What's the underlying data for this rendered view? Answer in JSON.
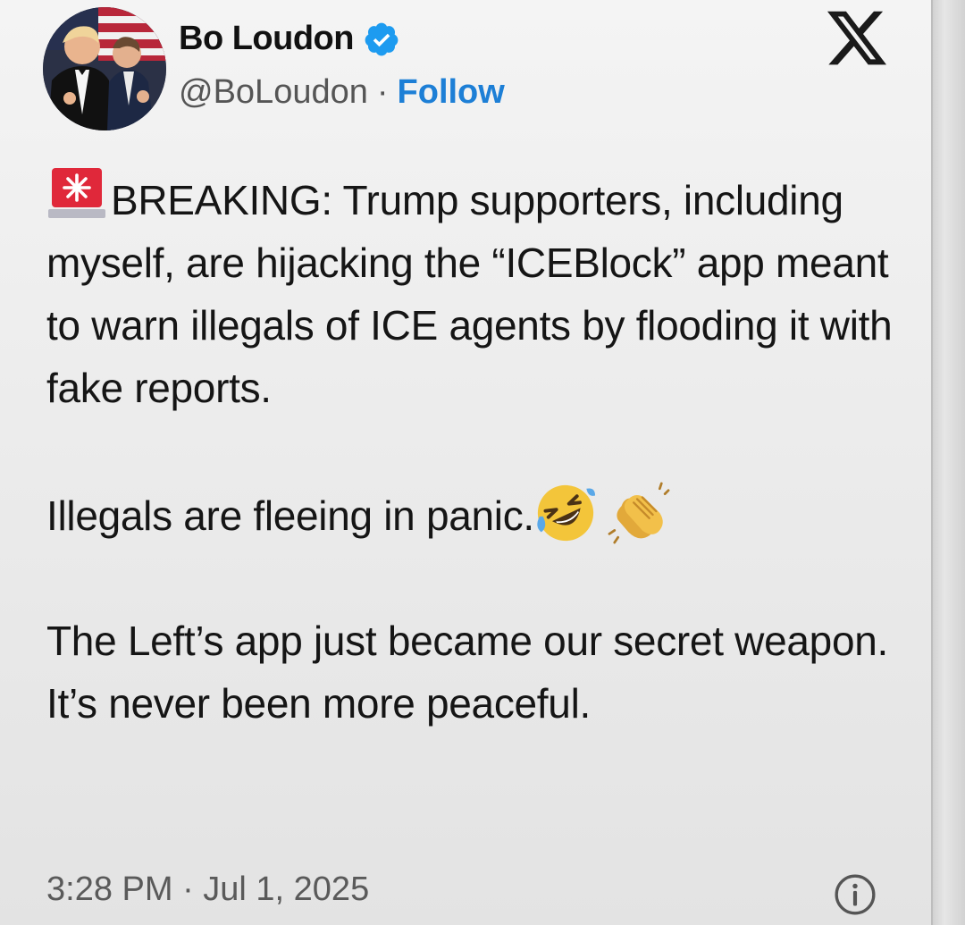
{
  "author": {
    "display_name": "Bo Loudon",
    "handle": "@BoLoudon",
    "separator": "·",
    "follow_label": "Follow",
    "verified": true
  },
  "tweet": {
    "paragraphs": [
      {
        "emoji_before": "siren-icon",
        "text": "BREAKING: Trump supporters, including myself, are hijacking the “ICEBlock” app meant to warn illegals of ICE agents by flooding it with fake reports."
      },
      {
        "text": "Illegals are fleeing in panic.",
        "emoji_after": [
          "rolling-laughing-emoji",
          "clapping-hands-emoji"
        ]
      },
      {
        "text": "The Left’s app just became our secret weapon. It’s never been more peaceful."
      }
    ],
    "timestamp": "3:28 PM · Jul 1, 2025"
  },
  "icons": {
    "platform": "x-logo-icon",
    "info": "info-icon",
    "verified": "verified-badge-icon"
  },
  "colors": {
    "follow": "#1d7fd6",
    "verified": "#1d9bf0",
    "siren": "#e0283a"
  }
}
